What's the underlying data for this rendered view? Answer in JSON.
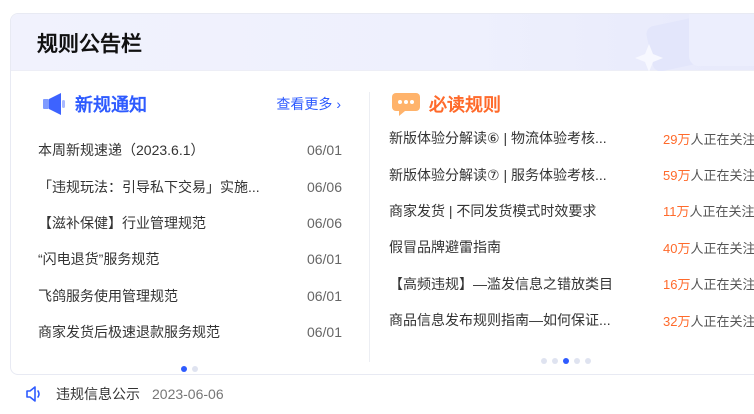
{
  "board": {
    "title": "规则公告栏"
  },
  "new_rules": {
    "title": "新规通知",
    "more_label": "查看更多",
    "items": [
      {
        "title": "本周新规速递（2023.6.1）",
        "date": "06/01"
      },
      {
        "title": "「违规玩法：引导私下交易」实施...",
        "date": "06/06"
      },
      {
        "title": "【滋补保健】行业管理规范",
        "date": "06/06"
      },
      {
        "title": "“闪电退货”服务规范",
        "date": "06/01"
      },
      {
        "title": "飞鸽服务使用管理规范",
        "date": "06/01"
      },
      {
        "title": "商家发货后极速退款服务规范",
        "date": "06/01"
      }
    ],
    "pages": 2,
    "active_page": 1
  },
  "must_read": {
    "title": "必读规则",
    "items": [
      {
        "title": "新版体验分解读⑥ | 物流体验考核...",
        "count": "29万",
        "suffix": "人正在关注"
      },
      {
        "title": "新版体验分解读⑦ | 服务体验考核...",
        "count": "59万",
        "suffix": "人正在关注"
      },
      {
        "title": "商家发货 | 不同发货模式时效要求",
        "count": "11万",
        "suffix": "人正在关注"
      },
      {
        "title": "假冒品牌避雷指南",
        "count": "40万",
        "suffix": "人正在关注"
      },
      {
        "title": "【高频违规】—滥发信息之错放类目",
        "count": "16万",
        "suffix": "人正在关注"
      },
      {
        "title": "商品信息发布规则指南—如何保证...",
        "count": "32万",
        "suffix": "人正在关注"
      }
    ],
    "pages": 5,
    "active_page": 3
  },
  "footer": {
    "label": "违规信息公示",
    "date": "2023-06-06",
    "icon": "speaker-icon"
  },
  "colors": {
    "accent_blue": "#2e5bff",
    "accent_orange": "#ff6a2b"
  }
}
